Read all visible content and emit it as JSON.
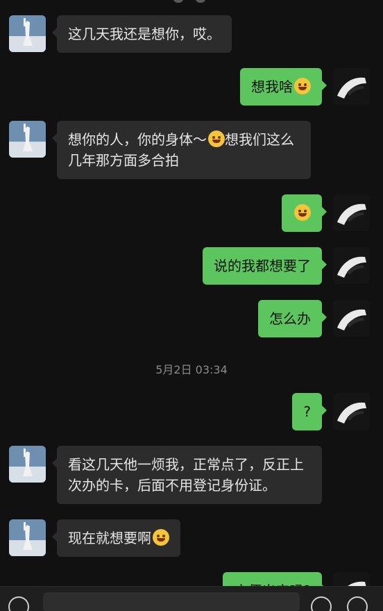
{
  "messages": [
    {
      "side": "left",
      "text": "这几天我还是想你，哎。"
    },
    {
      "side": "right",
      "text": "想我啥",
      "emoji": "woozy-face-emoji"
    },
    {
      "side": "left",
      "text_before": "想你的人，你的身体～",
      "emoji": "laughing-face-emoji",
      "text_after": "想我们这么几年那方面多合拍"
    },
    {
      "side": "right",
      "emoji": "grinning-face-emoji"
    },
    {
      "side": "right",
      "text": "说的我都想要了"
    },
    {
      "side": "right",
      "text": "怎么办"
    },
    {
      "side": "right",
      "text": "?"
    },
    {
      "side": "left",
      "text": "看这几天他一烦我，正常点了，反正上次办的卡，后面不用登记身份证。"
    },
    {
      "side": "left",
      "text": "现在就想要啊",
      "emoji": "thinking-face-emoji"
    },
    {
      "side": "right",
      "text": "方便出来吗?"
    }
  ],
  "timestamp": "5月2日 03:34",
  "colors": {
    "background": "#111111",
    "incoming_bubble": "#2c2c2c",
    "outgoing_bubble": "#5cc55d",
    "timestamp_text": "#8a8a8a"
  }
}
